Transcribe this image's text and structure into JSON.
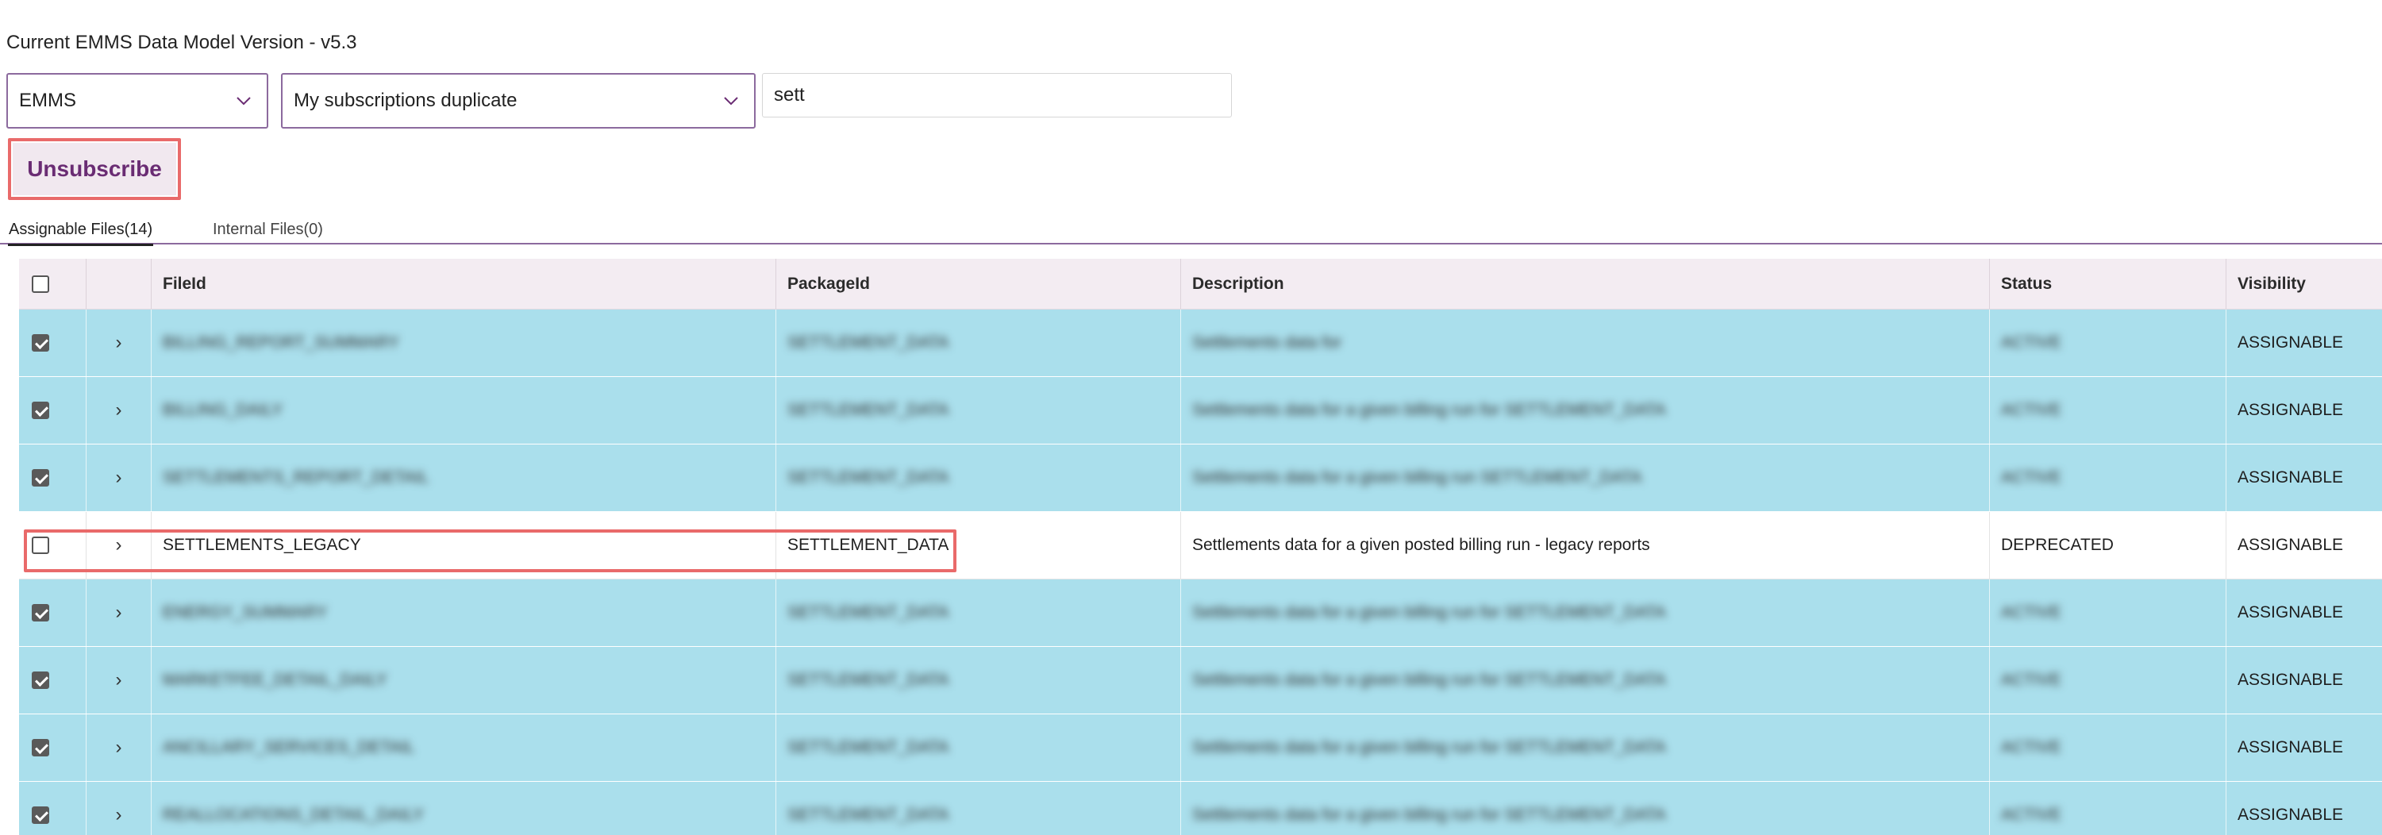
{
  "header": {
    "version_title": "Current EMMS Data Model Version - v5.3"
  },
  "filters": {
    "model_selected": "EMMS",
    "subscription_selected": "My subscriptions duplicate",
    "search_value": "sett"
  },
  "actions": {
    "unsubscribe_label": "Unsubscribe"
  },
  "tabs": [
    {
      "label": "Assignable Files(14)",
      "active": true
    },
    {
      "label": "Internal Files(0)",
      "active": false
    }
  ],
  "table": {
    "columns": [
      "FileId",
      "PackageId",
      "Description",
      "Status",
      "Visibility"
    ],
    "rows": [
      {
        "checked": true,
        "fileId": "BILLING_REPORT_SUMMARY",
        "packageId": "SETTLEMENT_DATA",
        "description": "Settlements data for",
        "status": "ACTIVE",
        "visibility": "ASSIGNABLE",
        "blurred": true
      },
      {
        "checked": true,
        "fileId": "BILLING_DAILY",
        "packageId": "SETTLEMENT_DATA",
        "description": "Settlements data for a given billing run for SETTLEMENT_DATA",
        "status": "ACTIVE",
        "visibility": "ASSIGNABLE",
        "blurred": true
      },
      {
        "checked": true,
        "fileId": "SETTLEMENTS_REPORT_DETAIL",
        "packageId": "SETTLEMENT_DATA",
        "description": "Settlements data for a given billing run SETTLEMENT_DATA",
        "status": "ACTIVE",
        "visibility": "ASSIGNABLE",
        "blurred": true
      },
      {
        "checked": false,
        "fileId": "SETTLEMENTS_LEGACY",
        "packageId": "SETTLEMENT_DATA",
        "description": "Settlements data for a given posted billing run - legacy reports",
        "status": "DEPRECATED",
        "visibility": "ASSIGNABLE",
        "blurred": false
      },
      {
        "checked": true,
        "fileId": "ENERGY_SUMMARY",
        "packageId": "SETTLEMENT_DATA",
        "description": "Settlements data for a given billing run for SETTLEMENT_DATA",
        "status": "ACTIVE",
        "visibility": "ASSIGNABLE",
        "blurred": true
      },
      {
        "checked": true,
        "fileId": "MARKETFEE_DETAIL_DAILY",
        "packageId": "SETTLEMENT_DATA",
        "description": "Settlements data for a given billing run for SETTLEMENT_DATA",
        "status": "ACTIVE",
        "visibility": "ASSIGNABLE",
        "blurred": true
      },
      {
        "checked": true,
        "fileId": "ANCILLARY_SERVICES_DETAIL",
        "packageId": "SETTLEMENT_DATA",
        "description": "Settlements data for a given billing run for SETTLEMENT_DATA",
        "status": "ACTIVE",
        "visibility": "ASSIGNABLE",
        "blurred": true
      },
      {
        "checked": true,
        "fileId": "REALLOCATIONS_DETAIL_DAILY",
        "packageId": "SETTLEMENT_DATA",
        "description": "Settlements data for a given billing run for SETTLEMENT_DATA",
        "status": "ACTIVE",
        "visibility": "ASSIGNABLE",
        "blurred": true
      }
    ]
  },
  "colors": {
    "accent": "#8c6a9e",
    "button_text": "#6a2c73",
    "button_bg": "#f1e8ef",
    "selected_row": "#aadfec",
    "header_bg": "#f3ecf2",
    "highlight": "#e96a6a"
  }
}
